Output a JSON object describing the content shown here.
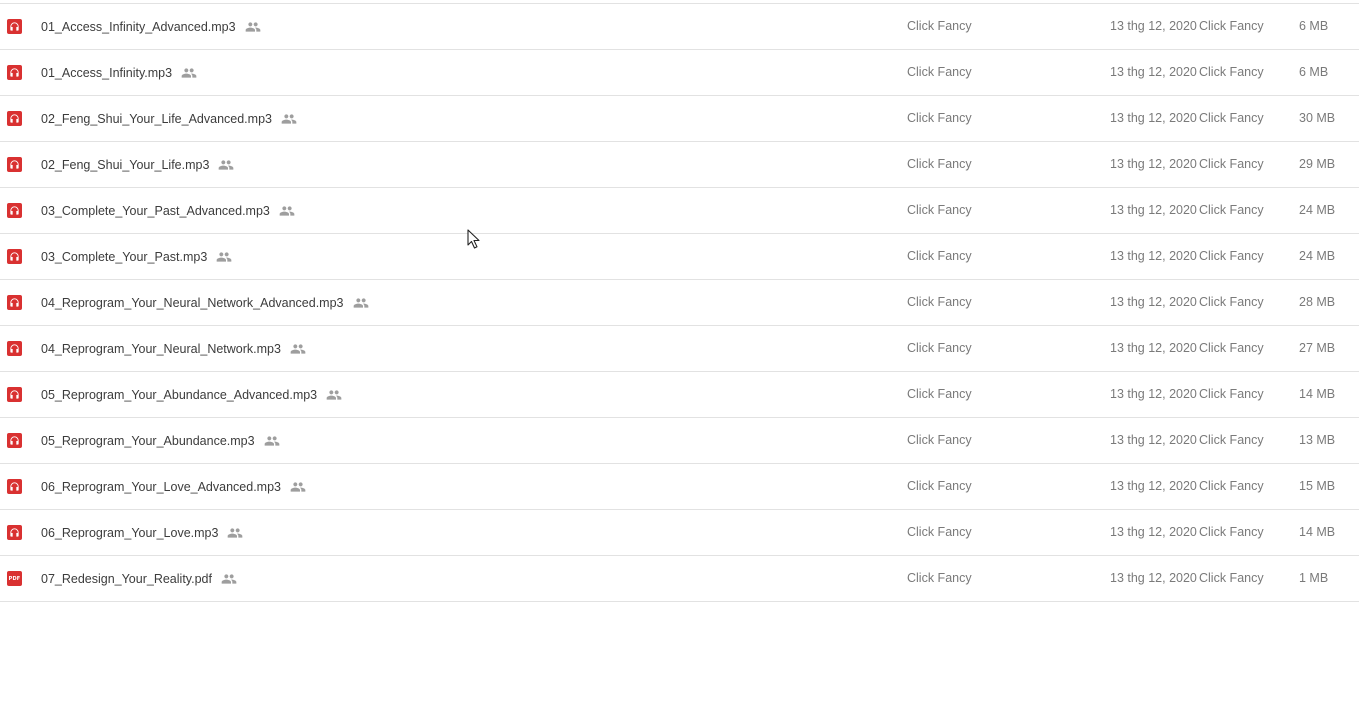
{
  "files": [
    {
      "name": "01_Access_Infinity_Advanced.mp3",
      "type": "audio",
      "owner": "Click Fancy",
      "modified": "13 thg 12, 2020",
      "modified_by": "Click Fancy",
      "size": "6 MB",
      "shared": true
    },
    {
      "name": "01_Access_Infinity.mp3",
      "type": "audio",
      "owner": "Click Fancy",
      "modified": "13 thg 12, 2020",
      "modified_by": "Click Fancy",
      "size": "6 MB",
      "shared": true
    },
    {
      "name": "02_Feng_Shui_Your_Life_Advanced.mp3",
      "type": "audio",
      "owner": "Click Fancy",
      "modified": "13 thg 12, 2020",
      "modified_by": "Click Fancy",
      "size": "30 MB",
      "shared": true
    },
    {
      "name": "02_Feng_Shui_Your_Life.mp3",
      "type": "audio",
      "owner": "Click Fancy",
      "modified": "13 thg 12, 2020",
      "modified_by": "Click Fancy",
      "size": "29 MB",
      "shared": true
    },
    {
      "name": "03_Complete_Your_Past_Advanced.mp3",
      "type": "audio",
      "owner": "Click Fancy",
      "modified": "13 thg 12, 2020",
      "modified_by": "Click Fancy",
      "size": "24 MB",
      "shared": true
    },
    {
      "name": "03_Complete_Your_Past.mp3",
      "type": "audio",
      "owner": "Click Fancy",
      "modified": "13 thg 12, 2020",
      "modified_by": "Click Fancy",
      "size": "24 MB",
      "shared": true
    },
    {
      "name": "04_Reprogram_Your_Neural_Network_Advanced.mp3",
      "type": "audio",
      "owner": "Click Fancy",
      "modified": "13 thg 12, 2020",
      "modified_by": "Click Fancy",
      "size": "28 MB",
      "shared": true
    },
    {
      "name": "04_Reprogram_Your_Neural_Network.mp3",
      "type": "audio",
      "owner": "Click Fancy",
      "modified": "13 thg 12, 2020",
      "modified_by": "Click Fancy",
      "size": "27 MB",
      "shared": true
    },
    {
      "name": "05_Reprogram_Your_Abundance_Advanced.mp3",
      "type": "audio",
      "owner": "Click Fancy",
      "modified": "13 thg 12, 2020",
      "modified_by": "Click Fancy",
      "size": "14 MB",
      "shared": true
    },
    {
      "name": "05_Reprogram_Your_Abundance.mp3",
      "type": "audio",
      "owner": "Click Fancy",
      "modified": "13 thg 12, 2020",
      "modified_by": "Click Fancy",
      "size": "13 MB",
      "shared": true
    },
    {
      "name": "06_Reprogram_Your_Love_Advanced.mp3",
      "type": "audio",
      "owner": "Click Fancy",
      "modified": "13 thg 12, 2020",
      "modified_by": "Click Fancy",
      "size": "15 MB",
      "shared": true
    },
    {
      "name": "06_Reprogram_Your_Love.mp3",
      "type": "audio",
      "owner": "Click Fancy",
      "modified": "13 thg 12, 2020",
      "modified_by": "Click Fancy",
      "size": "14 MB",
      "shared": true
    },
    {
      "name": "07_Redesign_Your_Reality.pdf",
      "type": "pdf",
      "owner": "Click Fancy",
      "modified": "13 thg 12, 2020",
      "modified_by": "Click Fancy",
      "size": "1 MB",
      "shared": true
    }
  ],
  "icons": {
    "audio": "headphones-icon",
    "pdf": "pdf-icon",
    "shared": "people-icon",
    "cursor": "mouse-pointer-icon"
  },
  "pdf_icon_text": "PDF",
  "colors": {
    "file_icon_red": "#d93131",
    "shared_icon_gray": "#9e9e9e",
    "row_divider": "#e2e2e2"
  }
}
